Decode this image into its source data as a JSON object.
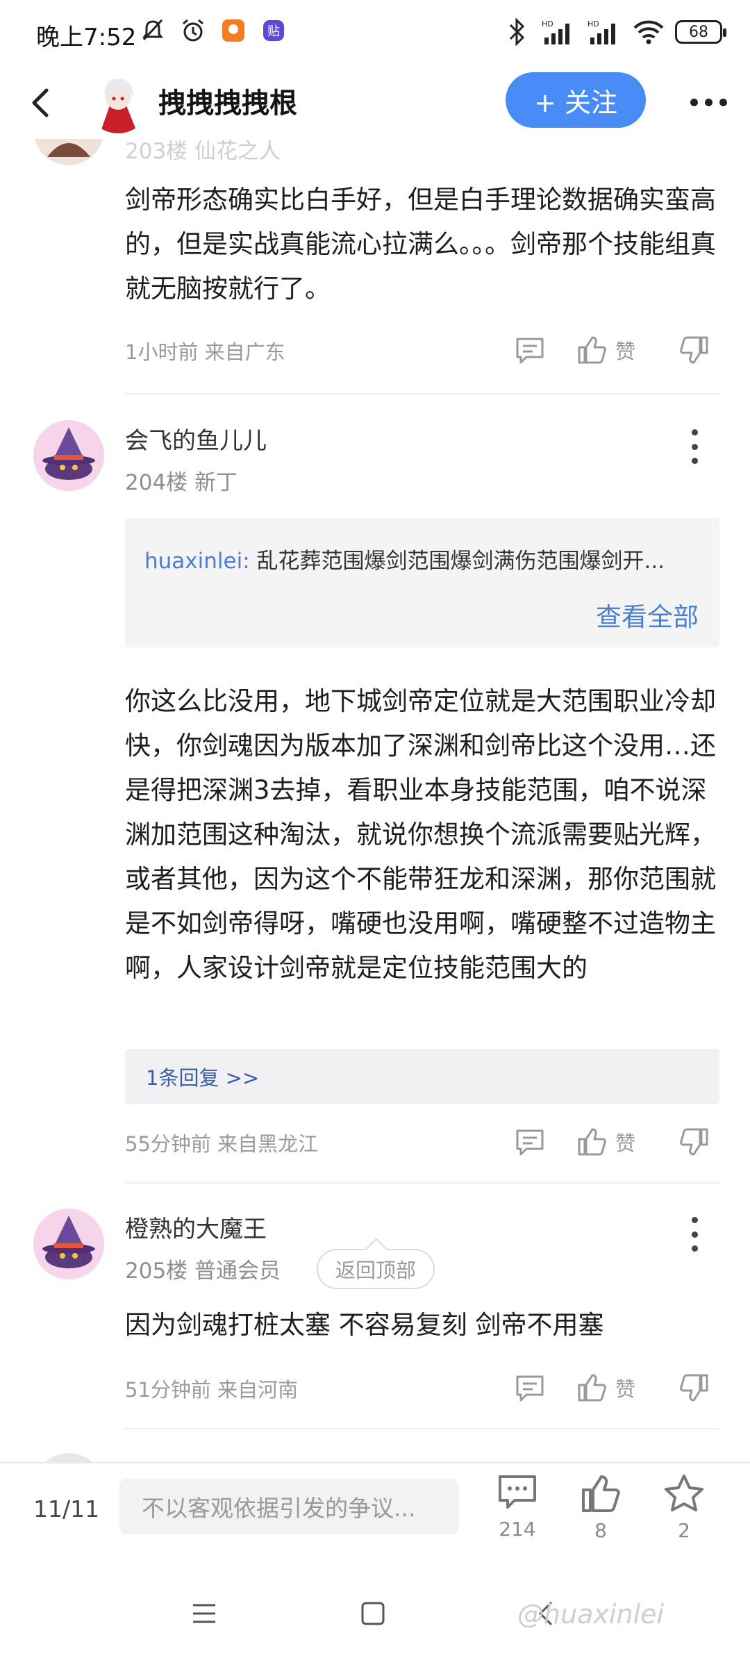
{
  "status_bar": {
    "time": "晚上7:52",
    "battery": "68",
    "hd1": "HD",
    "hd2": "HD",
    "app_badge": "贴"
  },
  "header": {
    "title": "拽拽拽拽根",
    "follow_label": "+ 关注"
  },
  "posts": [
    {
      "floor_partial": "203楼  仙花之人",
      "text": "剑帝形态确实比白手好，但是白手理论数据确实蛮高的，但是实战真能流心拉满么。。。剑帝那个技能组真就无脑按就行了。",
      "time": "1小时前 来自广东",
      "like_label": "赞"
    },
    {
      "username": "会飞的鱼儿儿",
      "meta": "204楼 新丁",
      "quote_user": "huaxinlei:",
      "quote_text": " 乱花葬范围爆剑范围爆剑满伤范围爆剑开...",
      "quote_more": "查看全部",
      "text": "你这么比没用，地下城剑帝定位就是大范围职业冷却快，你剑魂因为版本加了深渊和剑帝比这个没用…还是得把深渊3去掉，看职业本身技能范围，咱不说深渊加范围这种淘汰，就说你想换个流派需要贴光辉，或者其他，因为这个不能带狂龙和深渊，那你范围就是不如剑帝得呀，嘴硬也没用啊，嘴硬整不过造物主啊，人家设计剑帝就是定位技能范围大的",
      "reply_count": "1条回复 >>",
      "time": "55分钟前 来自黑龙江",
      "like_label": "赞"
    },
    {
      "username": "橙熟的大魔王",
      "meta": "205楼 普通会员",
      "text": "因为剑魂打桩太塞 不容易复刻 剑帝不用塞",
      "time": "51分钟前 来自河南",
      "like_label": "赞"
    }
  ],
  "back_to_top": "返回顶部",
  "bottom_bar": {
    "page": "11/11",
    "input_placeholder": "不以客观依据引发的争议...",
    "comments": "214",
    "likes": "8",
    "stars": "2"
  },
  "watermark": "@huaxinlei",
  "colors": {
    "accent": "#4a8cf7",
    "link": "#4a7fd4",
    "avatar_bg": "#f6d5ea"
  }
}
